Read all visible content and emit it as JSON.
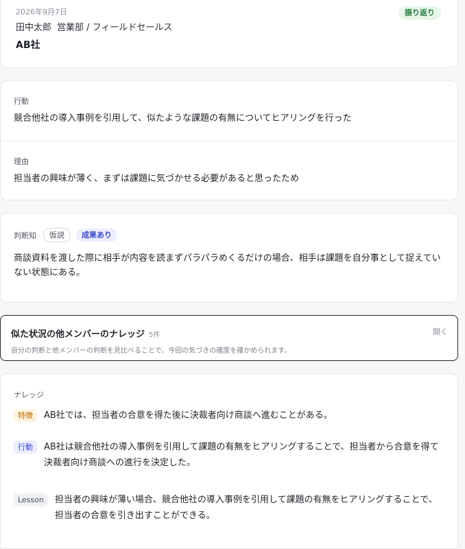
{
  "header": {
    "date": "2026年9月7日",
    "author_name": "田中太郎",
    "author_dept": "営業部 / フィールドセールス",
    "company": "AB社",
    "badge": "振り返り"
  },
  "action": {
    "label": "行動",
    "text": "競合他社の導入事例を引用して、似たような課題の有無についてヒアリングを行った"
  },
  "reason": {
    "label": "理由",
    "text": "担当者の興味が薄く、まずは課題に気づかせる必要があると思ったため"
  },
  "judgement": {
    "label": "判断知",
    "tag_hypothesis": "仮説",
    "tag_result": "成果あり",
    "text": "商談資料を渡した際に相手が内容を読まずパラパラめくるだけの場合、相手は課題を自分事として捉えていない状態にある。"
  },
  "similar": {
    "title": "似た状況の他メンバーのナレッジ",
    "count": "5件",
    "subtitle": "自分の判断と他メンバーの判断を見比べることで、今回の気づきの確度を確かめられます。",
    "open_label": "開く"
  },
  "knowledge": {
    "label": "ナレッジ",
    "items": [
      {
        "tag": "特徴",
        "text": "AB社では、担当者の合意を得た後に決裁者向け商談へ進むことがある。"
      },
      {
        "tag": "行動",
        "text": "AB社は競合他社の導入事例を引用して課題の有無をヒアリングすることで、担当者から合意を得て決裁者向け商談への進行を決定した。"
      },
      {
        "tag": "Lesson",
        "text": "担当者の興味が薄い場合、競合他社の導入事例を引用して課題の有無をヒアリングすることで、担当者の合意を引き出すことができる。"
      }
    ]
  },
  "colors": {
    "review_badge": "#237a3b",
    "result_badge": "#3b49c9",
    "feature_tag": "#b86a00"
  }
}
